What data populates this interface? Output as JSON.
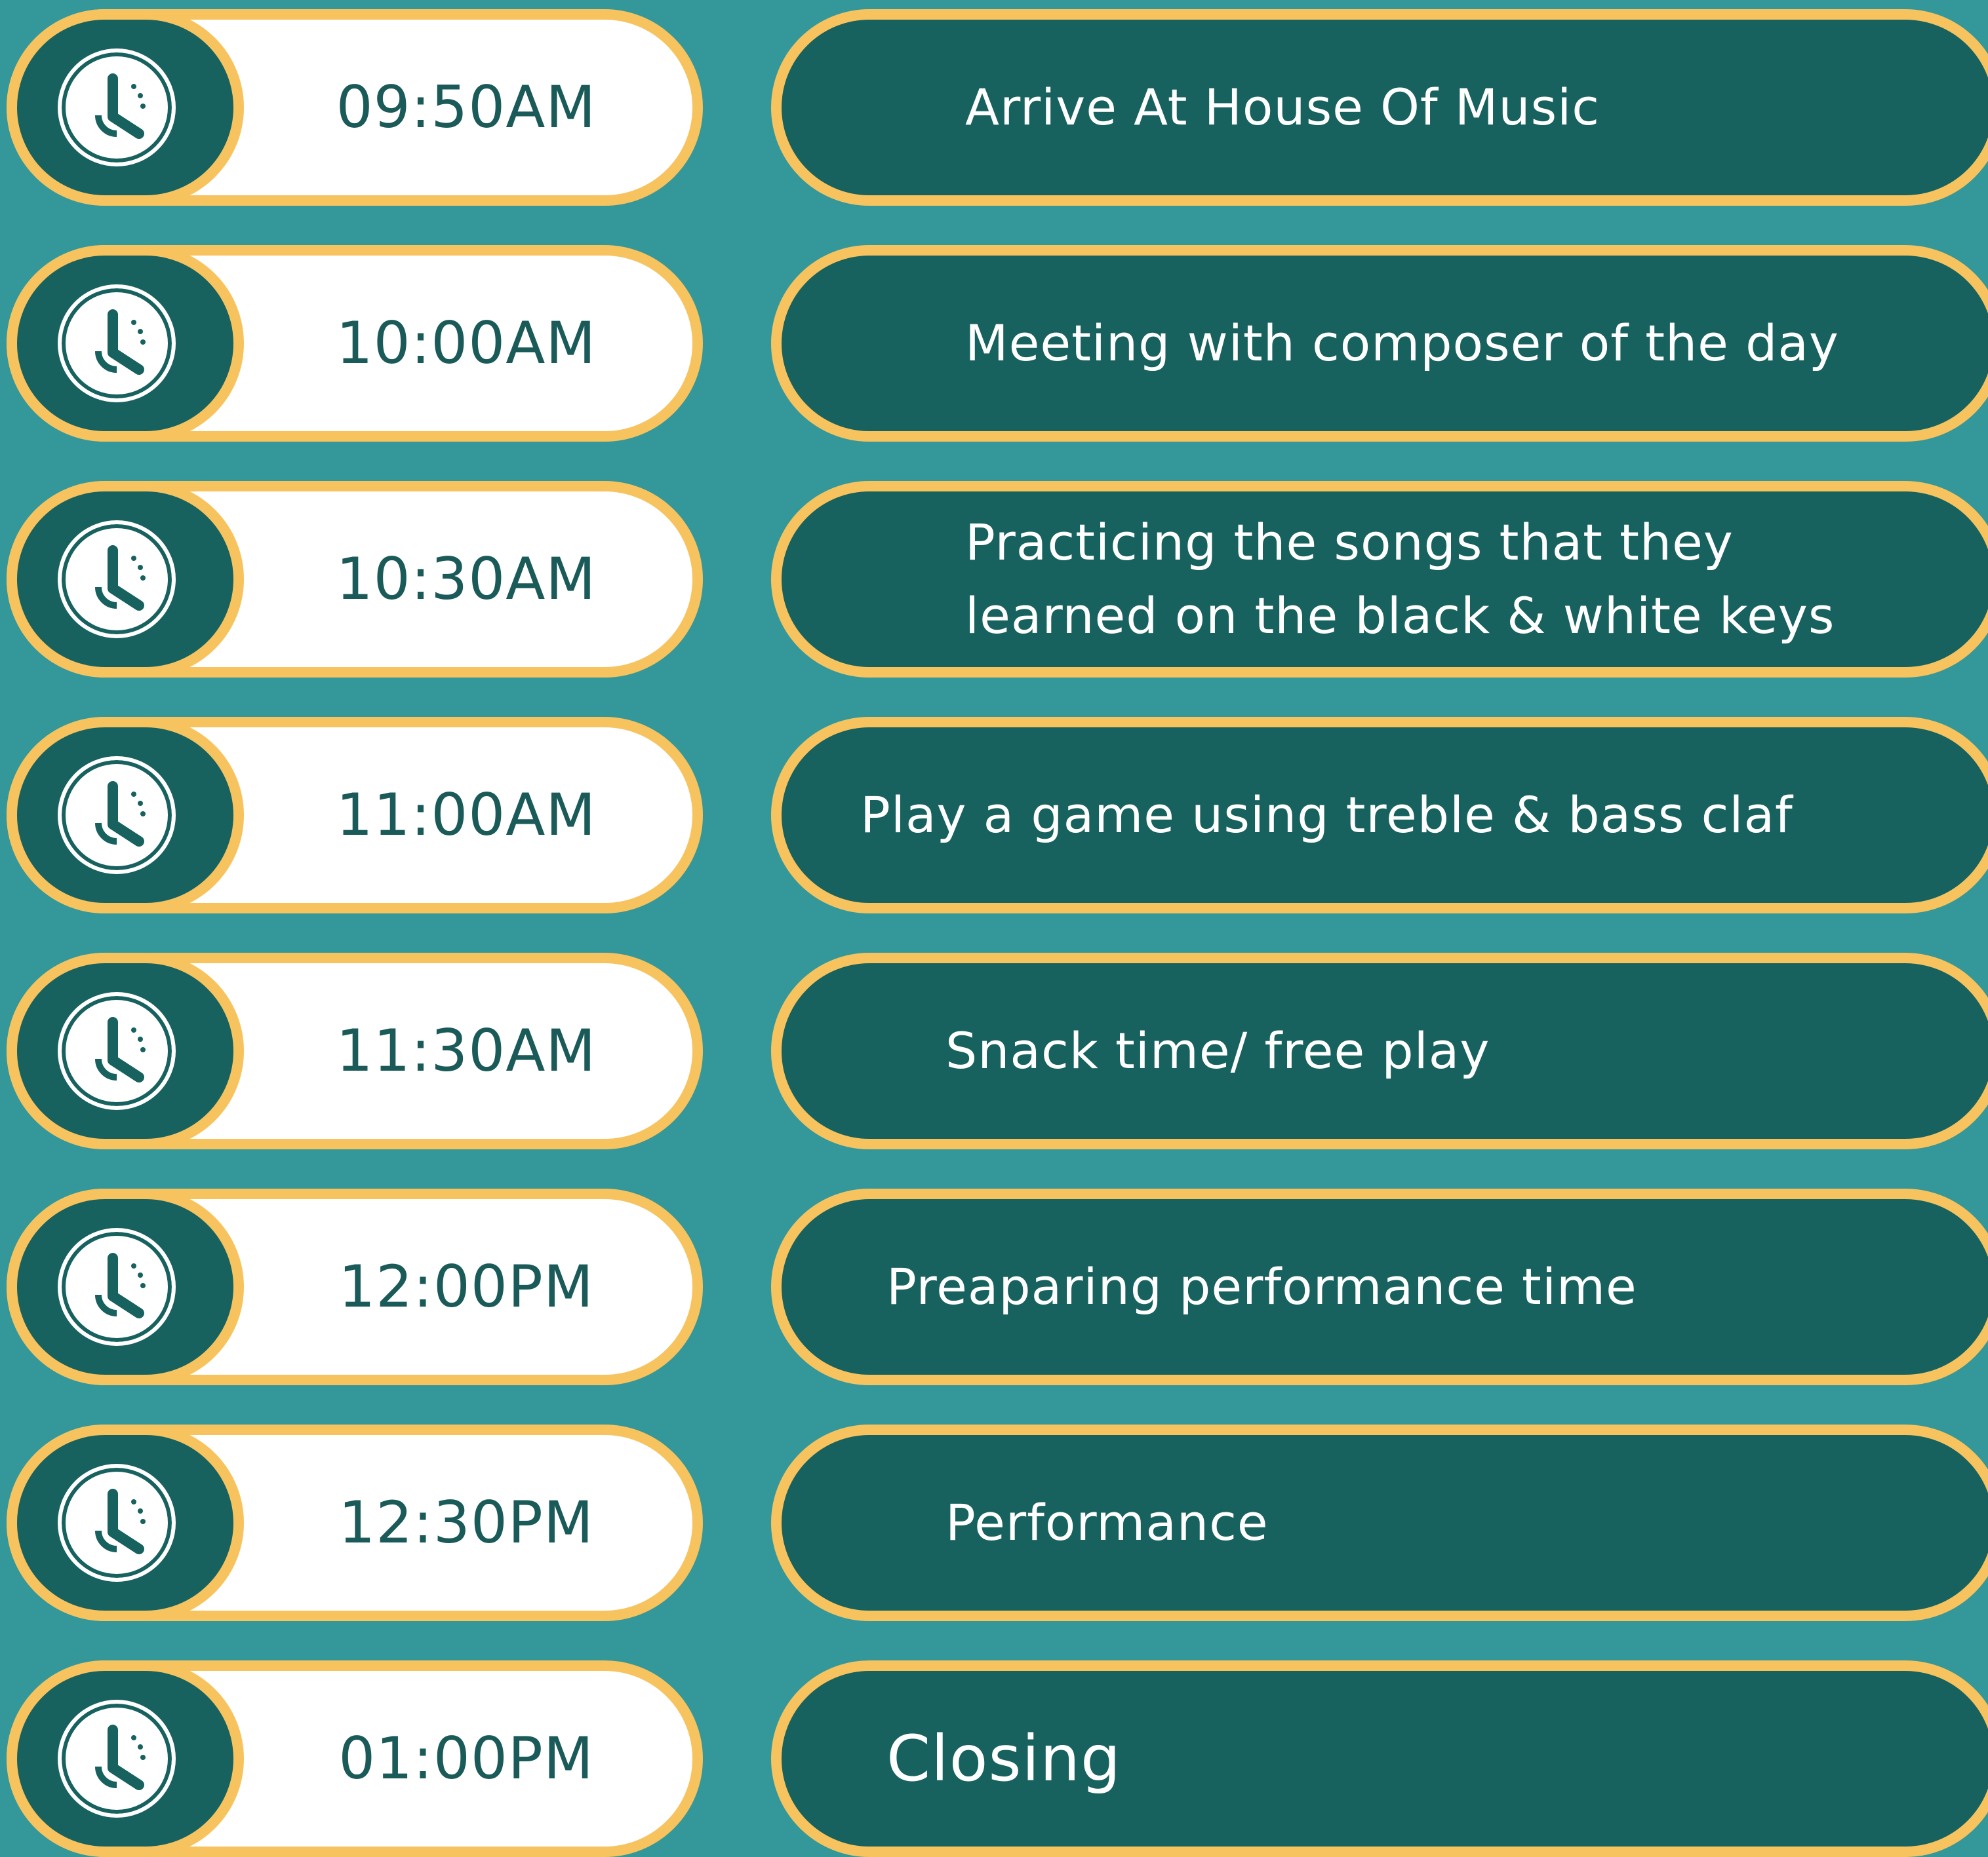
{
  "colors": {
    "background": "#34979a",
    "pill_dark": "#17615f",
    "pill_light": "#ffffff",
    "border": "#f7c35e",
    "time_text": "#1a5a58",
    "activity_text": "#ffffff"
  },
  "schedule": [
    {
      "time": "09:50AM",
      "activity": "Arrive At House Of Music",
      "icon": "clock-icon"
    },
    {
      "time": "10:00AM",
      "activity": "Meeting with composer of the day",
      "icon": "clock-icon"
    },
    {
      "time": "10:30AM",
      "activity": "Practicing the songs that they\nlearned  on the black & white keys",
      "icon": "clock-icon"
    },
    {
      "time": "11:00AM",
      "activity": "Play a game using treble & bass claf",
      "icon": "clock-icon"
    },
    {
      "time": "11:30AM",
      "activity": "Snack time/ free play",
      "icon": "clock-icon"
    },
    {
      "time": "12:00PM",
      "activity": "Preaparing performance time",
      "icon": "clock-icon"
    },
    {
      "time": "12:30PM",
      "activity": "Performance",
      "icon": "clock-icon"
    },
    {
      "time": "01:00PM",
      "activity": "Closing",
      "icon": "clock-icon"
    }
  ]
}
